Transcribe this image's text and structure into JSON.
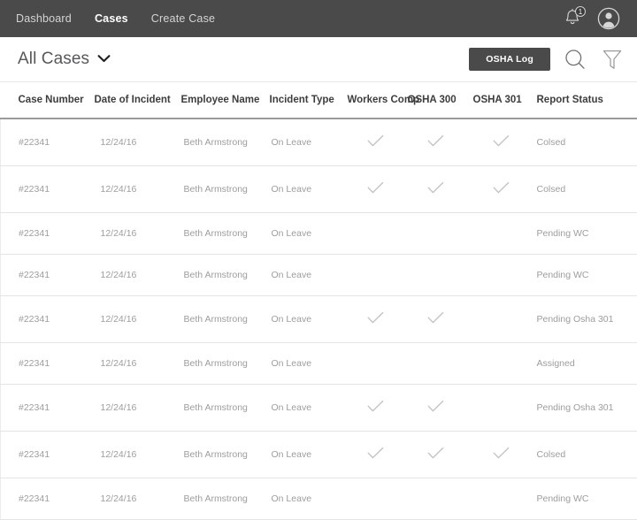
{
  "navbar": {
    "items": [
      {
        "label": "Dashboard",
        "active": false
      },
      {
        "label": "Cases",
        "active": true
      },
      {
        "label": "Create Case",
        "active": false
      }
    ],
    "notification_icon": "bell-icon",
    "notification_count": "1",
    "avatar_icon": "user-avatar-icon",
    "background_color": "#4a4a4a"
  },
  "header": {
    "title": "All Cases",
    "dropdown_icon": "chevron-down-icon",
    "osha_log_label": "OSHA Log",
    "search_icon": "search-icon",
    "filter_icon": "filter-icon",
    "button_color": "#4a4a4a"
  },
  "table": {
    "columns": [
      "Case Number",
      "Date of Incident",
      "Employee Name",
      "Incident Type",
      "Workers Comp",
      "OSHA 300",
      "OSHA 301",
      "Report Status"
    ],
    "rows": [
      {
        "case_number": "#22341",
        "date_of_incident": "12/24/16",
        "employee_name": "Beth Armstrong",
        "incident_type": "On Leave",
        "workers_comp": true,
        "osha_300": true,
        "osha_301": true,
        "report_status": "Colsed"
      },
      {
        "case_number": "#22341",
        "date_of_incident": "12/24/16",
        "employee_name": "Beth Armstrong",
        "incident_type": "On Leave",
        "workers_comp": true,
        "osha_300": true,
        "osha_301": true,
        "report_status": "Colsed"
      },
      {
        "case_number": "#22341",
        "date_of_incident": "12/24/16",
        "employee_name": "Beth Armstrong",
        "incident_type": "On Leave",
        "workers_comp": false,
        "osha_300": false,
        "osha_301": false,
        "report_status": "Pending WC"
      },
      {
        "case_number": "#22341",
        "date_of_incident": "12/24/16",
        "employee_name": "Beth Armstrong",
        "incident_type": "On Leave",
        "workers_comp": false,
        "osha_300": false,
        "osha_301": false,
        "report_status": "Pending WC"
      },
      {
        "case_number": "#22341",
        "date_of_incident": "12/24/16",
        "employee_name": "Beth Armstrong",
        "incident_type": "On Leave",
        "workers_comp": true,
        "osha_300": true,
        "osha_301": false,
        "report_status": "Pending Osha 301"
      },
      {
        "case_number": "#22341",
        "date_of_incident": "12/24/16",
        "employee_name": "Beth Armstrong",
        "incident_type": "On Leave",
        "workers_comp": false,
        "osha_300": false,
        "osha_301": false,
        "report_status": "Assigned"
      },
      {
        "case_number": "#22341",
        "date_of_incident": "12/24/16",
        "employee_name": "Beth Armstrong",
        "incident_type": "On Leave",
        "workers_comp": true,
        "osha_300": true,
        "osha_301": false,
        "report_status": "Pending Osha 301"
      },
      {
        "case_number": "#22341",
        "date_of_incident": "12/24/16",
        "employee_name": "Beth Armstrong",
        "incident_type": "On Leave",
        "workers_comp": true,
        "osha_300": true,
        "osha_301": true,
        "report_status": "Colsed"
      },
      {
        "case_number": "#22341",
        "date_of_incident": "12/24/16",
        "employee_name": "Beth Armstrong",
        "incident_type": "On Leave",
        "workers_comp": false,
        "osha_300": false,
        "osha_301": false,
        "report_status": "Pending WC"
      }
    ]
  }
}
